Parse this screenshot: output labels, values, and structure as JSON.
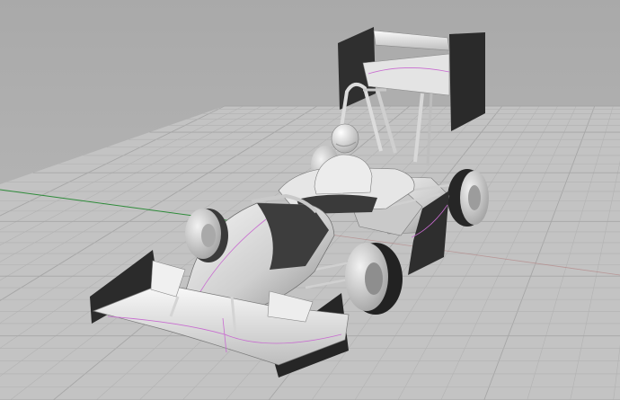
{
  "viewport": {
    "view": "perspective",
    "background_top": "#a9a9a9",
    "background_bottom": "#bdbdbd",
    "grid": {
      "visible": true,
      "plane_color": "#c3c3c3",
      "minor_color": "#b2b2b2",
      "major_color": "#a6a6a6",
      "x_axis_color": "#b07a7a",
      "y_axis_color": "#2e8b3a"
    },
    "model": {
      "name": "formula-student-race-car",
      "shading": "shaded",
      "body_color": "#d6d6d6",
      "shadow_color": "#3c3c3c",
      "edge_color": "#c86bd0",
      "parts": [
        "front-wing",
        "nose-cone",
        "cockpit",
        "driver-helmet",
        "roll-hoop",
        "rear-wing",
        "front-left-wheel",
        "front-right-wheel",
        "rear-left-wheel",
        "rear-right-wheel",
        "side-pod",
        "suspension-arms"
      ]
    }
  }
}
